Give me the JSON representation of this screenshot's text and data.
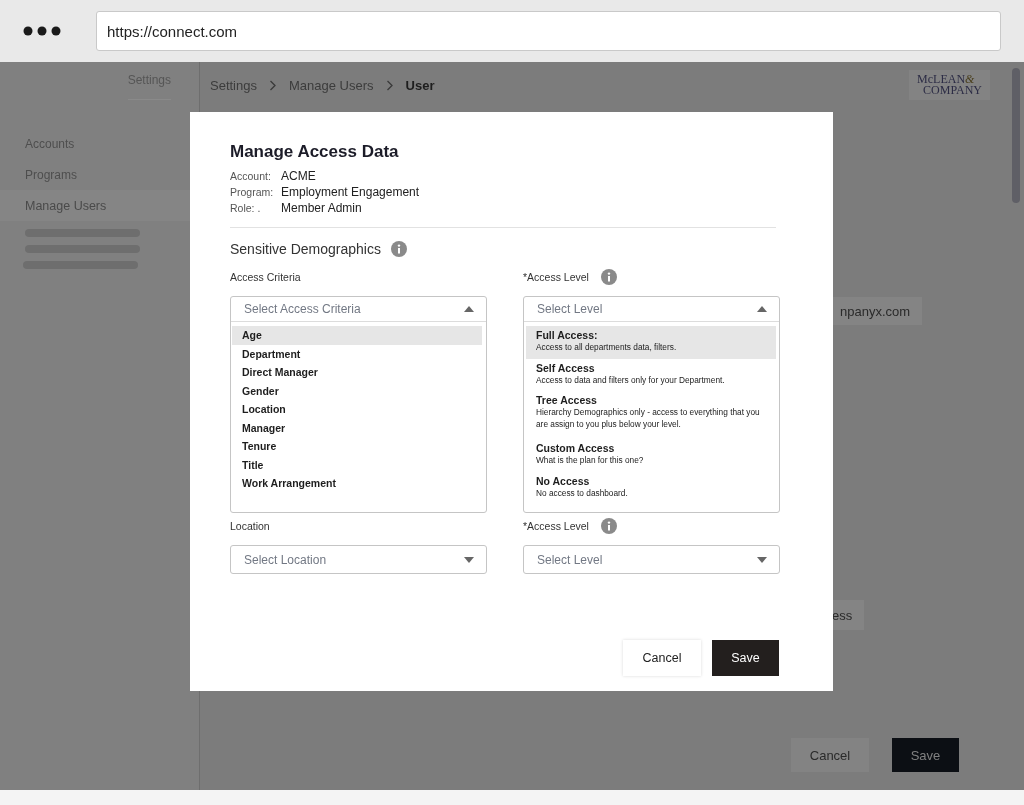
{
  "browser": {
    "url": "https://connect.com"
  },
  "background_page": {
    "sidebar_tab": "Settings",
    "sidebar": {
      "items": [
        {
          "label": "Accounts",
          "selected": false
        },
        {
          "label": "Programs",
          "selected": false
        },
        {
          "label": "Manage Users",
          "selected": true
        }
      ]
    },
    "breadcrumb": [
      {
        "label": "Settings",
        "current": false
      },
      {
        "label": "Manage Users",
        "current": false
      },
      {
        "label": "User",
        "current": true
      }
    ],
    "logo": {
      "line_1": "McLEAN",
      "ampersand": "&",
      "line_2": "COMPANY"
    },
    "email_fragment": "npanyx.com",
    "button_fragment": "ess",
    "buttons": [
      {
        "label": "Cancel",
        "kind": "secondary"
      },
      {
        "label": "Save",
        "kind": "primary"
      }
    ]
  },
  "modal": {
    "title": "Manage Access Data",
    "meta": [
      {
        "label": "Account:",
        "value": "ACME"
      },
      {
        "label": "Program:",
        "value": "Employment Engagement"
      },
      {
        "label": "Role: .",
        "value": "Member Admin"
      }
    ],
    "section": "Sensitive Demographics",
    "rows": [
      {
        "criteria": {
          "label": "Access Criteria",
          "placeholder": "Select Access Criteria",
          "expanded": true,
          "options": [
            {
              "label": "Age",
              "selected": true
            },
            {
              "label": "Department",
              "selected": false
            },
            {
              "label": "Direct Manager",
              "selected": false
            },
            {
              "label": "Gender",
              "selected": false
            },
            {
              "label": "Location",
              "selected": false
            },
            {
              "label": "Manager",
              "selected": false
            },
            {
              "label": "Tenure",
              "selected": false
            },
            {
              "label": "Title",
              "selected": false
            },
            {
              "label": "Work Arrangement",
              "selected": false
            }
          ]
        },
        "level": {
          "label": "*Access Level",
          "placeholder": "Select Level",
          "expanded": true,
          "options": [
            {
              "title": "Full Access:",
              "description": "Access to all departments data, filters.",
              "selected": true
            },
            {
              "title": "Self Access",
              "description": "Access to data and  filters only for your Department.",
              "selected": false
            },
            {
              "title": "Tree Access",
              "description": "Hierarchy Demographics only - access to everything that you are assign to you plus below your level.",
              "selected": false
            },
            {
              "title": "Custom Access",
              "description": "What is the plan for this one?",
              "selected": false
            },
            {
              "title": "No Access",
              "description": "No access to dashboard.",
              "selected": false
            }
          ]
        }
      },
      {
        "criteria": {
          "label": "Location",
          "placeholder": "Select Location",
          "expanded": false
        },
        "level": {
          "label": "*Access Level",
          "placeholder": "Select Level",
          "expanded": false
        }
      }
    ],
    "buttons": [
      {
        "label": "Cancel",
        "kind": "secondary"
      },
      {
        "label": "Save",
        "kind": "primary"
      }
    ]
  }
}
